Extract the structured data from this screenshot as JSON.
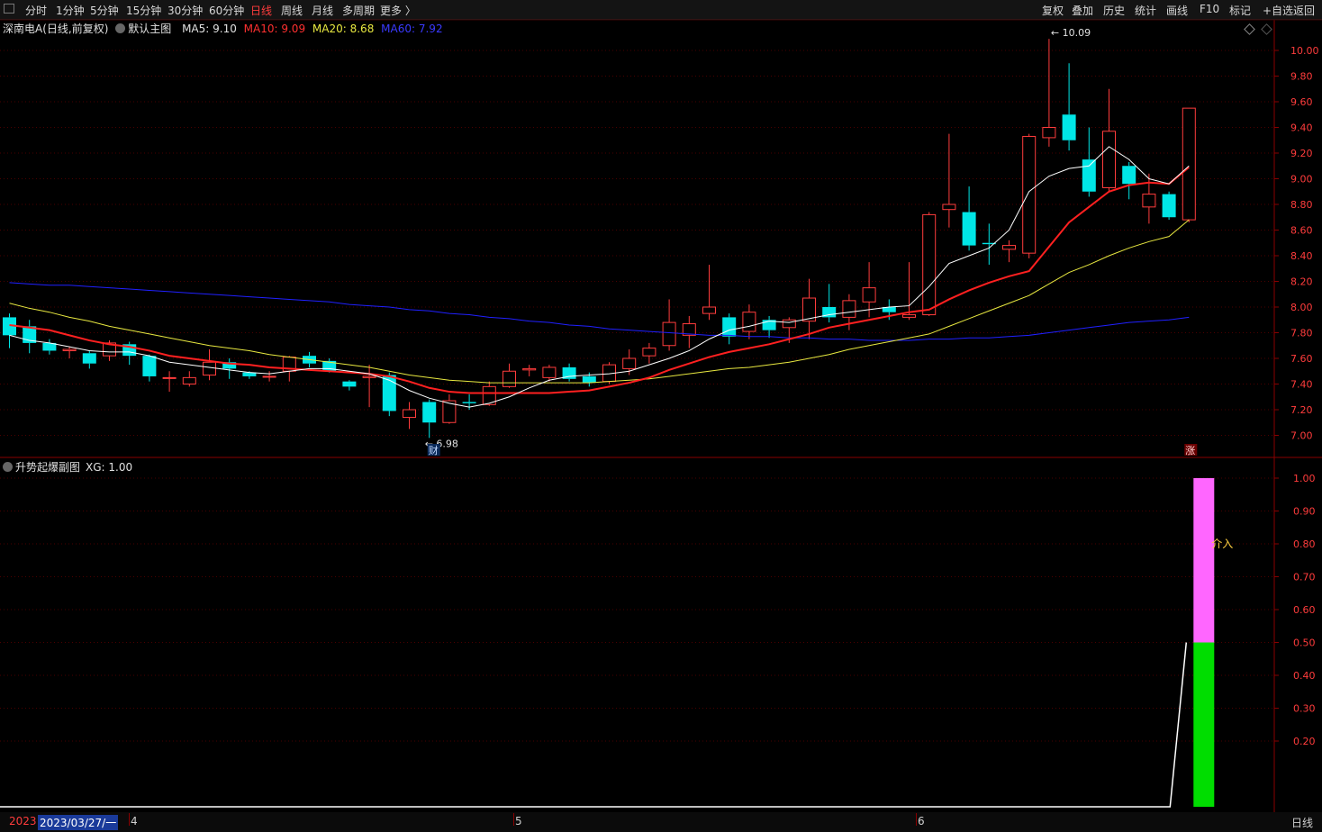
{
  "toolbar": {
    "periods": [
      "分时",
      "1分钟",
      "5分钟",
      "15分钟",
      "30分钟",
      "60分钟",
      "日线",
      "周线",
      "月线",
      "多周期",
      "更多 〉"
    ],
    "active": "日线",
    "right_buttons": [
      "复权",
      "叠加",
      "历史",
      "统计",
      "画线",
      "F10",
      "标记",
      "+自选",
      "返回"
    ]
  },
  "main_info": {
    "stock": "深南电A(日线,前复权)",
    "template": "默认主图",
    "ma5": "MA5: 9.10",
    "ma10": "MA10: 9.09",
    "ma20": "MA20: 8.68",
    "ma60": "MA60: 7.92"
  },
  "sub_info": {
    "name": "升势起爆副图",
    "value": "XG: 1.00",
    "marker_label": "介入"
  },
  "markers": {
    "high_label": "10.09",
    "low_label": "6.98",
    "fin_badge": "财",
    "up_badge": "涨"
  },
  "colors": {
    "up": "#ff3c3c",
    "down": "#00e6e6",
    "ma5": "#ffffff",
    "ma10": "#ff2020",
    "ma20": "#e8e840",
    "ma60": "#2020ff",
    "grid": "#4a0000",
    "axis_text": "#ff3c3c"
  },
  "chart_data": [
    {
      "type": "candlestick",
      "title": "",
      "yticks": [
        "10.00",
        "9.80",
        "9.60",
        "9.40",
        "9.20",
        "9.00",
        "8.80",
        "8.60",
        "8.40",
        "8.20",
        "8.00",
        "7.80",
        "7.60",
        "7.40",
        "7.20",
        "7.00"
      ],
      "ylim": [
        6.84,
        10.32
      ],
      "date_labels": [
        "2023",
        "2023/03/27/一",
        "4",
        "5",
        "6"
      ],
      "candles": [
        {
          "o": 7.92,
          "c": 7.78,
          "h": 7.95,
          "l": 7.68
        },
        {
          "o": 7.85,
          "c": 7.72,
          "h": 7.9,
          "l": 7.64
        },
        {
          "o": 7.72,
          "c": 7.66,
          "h": 7.75,
          "l": 7.63
        },
        {
          "o": 7.66,
          "c": 7.67,
          "h": 7.69,
          "l": 7.6
        },
        {
          "o": 7.64,
          "c": 7.56,
          "h": 7.66,
          "l": 7.52
        },
        {
          "o": 7.62,
          "c": 7.72,
          "h": 7.74,
          "l": 7.58
        },
        {
          "o": 7.71,
          "c": 7.62,
          "h": 7.73,
          "l": 7.55
        },
        {
          "o": 7.62,
          "c": 7.46,
          "h": 7.63,
          "l": 7.42
        },
        {
          "o": 7.45,
          "c": 7.45,
          "h": 7.5,
          "l": 7.34
        },
        {
          "o": 7.4,
          "c": 7.45,
          "h": 7.5,
          "l": 7.38
        },
        {
          "o": 7.47,
          "c": 7.57,
          "h": 7.67,
          "l": 7.43
        },
        {
          "o": 7.57,
          "c": 7.52,
          "h": 7.6,
          "l": 7.44
        },
        {
          "o": 7.49,
          "c": 7.46,
          "h": 7.5,
          "l": 7.44
        },
        {
          "o": 7.46,
          "c": 7.46,
          "h": 7.5,
          "l": 7.42
        },
        {
          "o": 7.5,
          "c": 7.61,
          "h": 7.62,
          "l": 7.42
        },
        {
          "o": 7.62,
          "c": 7.56,
          "h": 7.65,
          "l": 7.53
        },
        {
          "o": 7.58,
          "c": 7.5,
          "h": 7.6,
          "l": 7.49
        },
        {
          "o": 7.42,
          "c": 7.38,
          "h": 7.43,
          "l": 7.35
        },
        {
          "o": 7.45,
          "c": 7.46,
          "h": 7.55,
          "l": 7.22
        },
        {
          "o": 7.47,
          "c": 7.19,
          "h": 7.49,
          "l": 7.15
        },
        {
          "o": 7.14,
          "c": 7.2,
          "h": 7.26,
          "l": 7.05
        },
        {
          "o": 7.26,
          "c": 7.1,
          "h": 7.28,
          "l": 6.98
        },
        {
          "o": 7.1,
          "c": 7.27,
          "h": 7.32,
          "l": 7.09
        },
        {
          "o": 7.26,
          "c": 7.25,
          "h": 7.32,
          "l": 7.2
        },
        {
          "o": 7.24,
          "c": 7.38,
          "h": 7.42,
          "l": 7.23
        },
        {
          "o": 7.38,
          "c": 7.5,
          "h": 7.56,
          "l": 7.37
        },
        {
          "o": 7.51,
          "c": 7.52,
          "h": 7.55,
          "l": 7.46
        },
        {
          "o": 7.45,
          "c": 7.53,
          "h": 7.55,
          "l": 7.42
        },
        {
          "o": 7.53,
          "c": 7.44,
          "h": 7.56,
          "l": 7.42
        },
        {
          "o": 7.46,
          "c": 7.41,
          "h": 7.49,
          "l": 7.38
        },
        {
          "o": 7.42,
          "c": 7.55,
          "h": 7.57,
          "l": 7.4
        },
        {
          "o": 7.52,
          "c": 7.6,
          "h": 7.67,
          "l": 7.47
        },
        {
          "o": 7.62,
          "c": 7.68,
          "h": 7.72,
          "l": 7.56
        },
        {
          "o": 7.7,
          "c": 7.88,
          "h": 8.06,
          "l": 7.66
        },
        {
          "o": 7.78,
          "c": 7.87,
          "h": 7.93,
          "l": 7.68
        },
        {
          "o": 7.95,
          "c": 8.0,
          "h": 8.33,
          "l": 7.9
        },
        {
          "o": 7.92,
          "c": 7.77,
          "h": 7.95,
          "l": 7.71
        },
        {
          "o": 7.81,
          "c": 7.96,
          "h": 8.02,
          "l": 7.75
        },
        {
          "o": 7.9,
          "c": 7.82,
          "h": 7.93,
          "l": 7.76
        },
        {
          "o": 7.84,
          "c": 7.9,
          "h": 7.92,
          "l": 7.72
        },
        {
          "o": 7.89,
          "c": 8.07,
          "h": 8.22,
          "l": 7.75
        },
        {
          "o": 8.0,
          "c": 7.92,
          "h": 8.18,
          "l": 7.88
        },
        {
          "o": 7.92,
          "c": 8.05,
          "h": 8.1,
          "l": 7.82
        },
        {
          "o": 8.04,
          "c": 8.15,
          "h": 8.35,
          "l": 7.92
        },
        {
          "o": 8.0,
          "c": 7.96,
          "h": 8.06,
          "l": 7.9
        },
        {
          "o": 7.92,
          "c": 7.94,
          "h": 8.35,
          "l": 7.9
        },
        {
          "o": 7.94,
          "c": 8.72,
          "h": 8.74,
          "l": 7.93
        },
        {
          "o": 8.76,
          "c": 8.8,
          "h": 9.35,
          "l": 8.62
        },
        {
          "o": 8.74,
          "c": 8.48,
          "h": 8.94,
          "l": 8.44
        },
        {
          "o": 8.5,
          "c": 8.49,
          "h": 8.65,
          "l": 8.33
        },
        {
          "o": 8.45,
          "c": 8.48,
          "h": 8.52,
          "l": 8.35
        },
        {
          "o": 8.42,
          "c": 9.33,
          "h": 9.35,
          "l": 8.38
        },
        {
          "o": 9.32,
          "c": 9.4,
          "h": 10.09,
          "l": 9.25
        },
        {
          "o": 9.5,
          "c": 9.3,
          "h": 9.9,
          "l": 9.22
        },
        {
          "o": 9.15,
          "c": 8.9,
          "h": 9.4,
          "l": 8.86
        },
        {
          "o": 8.93,
          "c": 9.37,
          "h": 9.7,
          "l": 8.9
        },
        {
          "o": 9.1,
          "c": 8.96,
          "h": 9.13,
          "l": 8.84
        },
        {
          "o": 8.78,
          "c": 8.88,
          "h": 9.04,
          "l": 8.65
        },
        {
          "o": 8.88,
          "c": 8.7,
          "h": 8.9,
          "l": 8.68
        },
        {
          "o": 8.68,
          "c": 9.55,
          "h": 9.55,
          "l": 8.66
        }
      ],
      "ma5": [
        7.78,
        7.74,
        7.72,
        7.69,
        7.66,
        7.65,
        7.65,
        7.62,
        7.57,
        7.55,
        7.53,
        7.51,
        7.49,
        7.48,
        7.5,
        7.52,
        7.52,
        7.5,
        7.48,
        7.43,
        7.35,
        7.29,
        7.25,
        7.22,
        7.25,
        7.3,
        7.37,
        7.43,
        7.46,
        7.47,
        7.48,
        7.5,
        7.55,
        7.6,
        7.66,
        7.75,
        7.82,
        7.85,
        7.89,
        7.88,
        7.91,
        7.94,
        7.96,
        7.98,
        8.0,
        8.01,
        8.16,
        8.34,
        8.4,
        8.46,
        8.6,
        8.9,
        9.02,
        9.08,
        9.1,
        9.25,
        9.15,
        9.0,
        8.96,
        9.1
      ],
      "ma10": [
        7.86,
        7.84,
        7.82,
        7.78,
        7.74,
        7.71,
        7.69,
        7.66,
        7.62,
        7.6,
        7.58,
        7.56,
        7.55,
        7.53,
        7.52,
        7.51,
        7.5,
        7.49,
        7.48,
        7.46,
        7.42,
        7.37,
        7.34,
        7.33,
        7.33,
        7.33,
        7.33,
        7.33,
        7.34,
        7.35,
        7.38,
        7.41,
        7.45,
        7.51,
        7.56,
        7.61,
        7.65,
        7.68,
        7.71,
        7.75,
        7.79,
        7.84,
        7.87,
        7.9,
        7.93,
        7.96,
        7.98,
        8.06,
        8.13,
        8.19,
        8.24,
        8.28,
        8.47,
        8.66,
        8.78,
        8.9,
        8.95,
        8.97,
        8.96,
        9.09
      ],
      "ma20": [
        8.03,
        7.99,
        7.96,
        7.92,
        7.89,
        7.85,
        7.82,
        7.79,
        7.76,
        7.73,
        7.7,
        7.68,
        7.66,
        7.63,
        7.61,
        7.59,
        7.57,
        7.55,
        7.53,
        7.5,
        7.47,
        7.45,
        7.43,
        7.42,
        7.41,
        7.41,
        7.41,
        7.41,
        7.41,
        7.41,
        7.42,
        7.43,
        7.44,
        7.46,
        7.48,
        7.5,
        7.52,
        7.53,
        7.55,
        7.57,
        7.6,
        7.63,
        7.67,
        7.7,
        7.73,
        7.76,
        7.79,
        7.85,
        7.91,
        7.97,
        8.03,
        8.09,
        8.18,
        8.27,
        8.33,
        8.4,
        8.46,
        8.51,
        8.55,
        8.68
      ],
      "ma60": [
        8.19,
        8.18,
        8.17,
        8.17,
        8.16,
        8.15,
        8.14,
        8.13,
        8.12,
        8.11,
        8.1,
        8.09,
        8.08,
        8.07,
        8.06,
        8.05,
        8.04,
        8.02,
        8.01,
        8.0,
        7.98,
        7.97,
        7.95,
        7.94,
        7.92,
        7.91,
        7.89,
        7.88,
        7.86,
        7.85,
        7.83,
        7.82,
        7.81,
        7.8,
        7.79,
        7.78,
        7.78,
        7.77,
        7.77,
        7.76,
        7.76,
        7.75,
        7.75,
        7.74,
        7.74,
        7.74,
        7.75,
        7.75,
        7.76,
        7.76,
        7.77,
        7.78,
        7.8,
        7.82,
        7.84,
        7.86,
        7.88,
        7.89,
        7.9,
        7.92
      ]
    },
    {
      "type": "bar",
      "title": "升势起爆副图",
      "yticks": [
        "1.00",
        "0.90",
        "0.80",
        "0.70",
        "0.60",
        "0.50",
        "0.40",
        "0.30",
        "0.20"
      ],
      "ylim": [
        0,
        1.05
      ],
      "xg": 1.0,
      "split": 0.5,
      "colors": {
        "top": "#ff66ff",
        "bottom": "#00dd00",
        "line": "#ffffff"
      }
    }
  ]
}
